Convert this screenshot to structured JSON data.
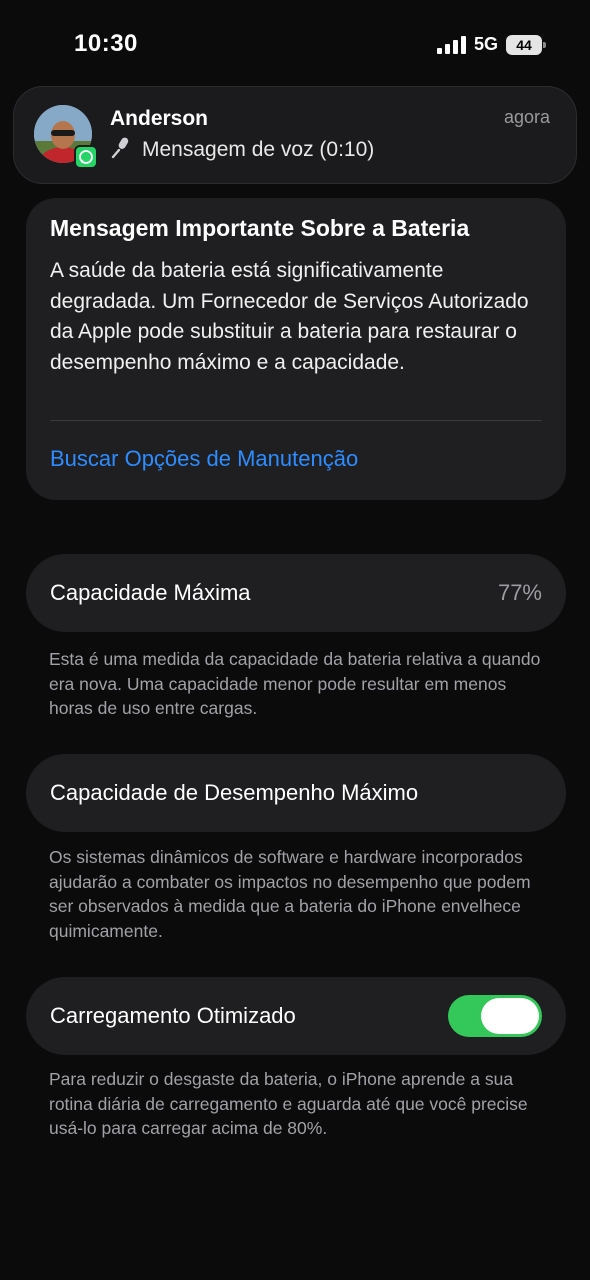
{
  "status_bar": {
    "time": "10:30",
    "network": "5G",
    "battery_level": "44"
  },
  "notification": {
    "app_icon": "whatsapp-icon",
    "sender": "Anderson",
    "message": "Mensagem de voz (0:10)",
    "message_icon": "microphone-icon",
    "timestamp": "agora"
  },
  "important_message": {
    "title": "Mensagem Importante Sobre a Bateria",
    "body": "A saúde da bateria está significativamente degradada. Um Fornecedor de Serviços Autorizado da Apple pode substituir a bateria para restaurar o desempenho máximo e a capacidade.",
    "link": "Buscar Opções de Manutenção"
  },
  "maximum_capacity": {
    "label": "Capacidade Máxima",
    "value": "77%",
    "footnote": "Esta é uma medida da capacidade da bateria relativa a quando era nova. Uma capacidade menor pode resultar em menos horas de uso entre cargas."
  },
  "peak_performance": {
    "label": "Capacidade de Desempenho Máximo",
    "footnote": "Os sistemas dinâmicos de software e hardware incorporados ajudarão a combater os impactos no desempenho que podem ser observados à medida que a bateria do iPhone envelhece quimicamente."
  },
  "optimized_charging": {
    "label": "Carregamento Otimizado",
    "enabled": true,
    "footnote": "Para reduzir o desgaste da bateria, o iPhone aprende a sua rotina diária de carregamento e aguarda até que você precise usá-lo para carregar acima de 80%."
  },
  "colors": {
    "link": "#2d8cff",
    "toggle_on": "#34c759",
    "card_bg": "#1f1f21",
    "whatsapp": "#25d366"
  }
}
